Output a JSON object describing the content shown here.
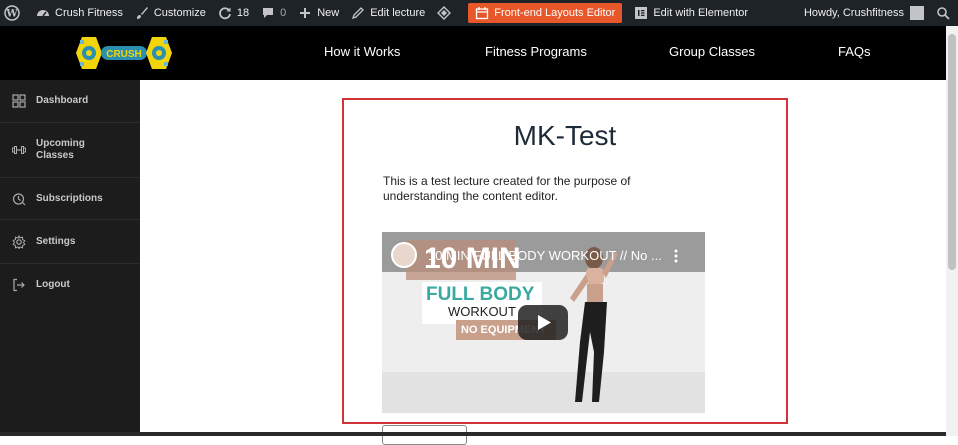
{
  "admin_bar": {
    "site_name": "Crush Fitness",
    "customize": "Customize",
    "updates_count": "18",
    "comments_count": "0",
    "new": "New",
    "edit_lecture": "Edit lecture",
    "layouts_editor": "Front-end Layouts Editor",
    "edit_elementor": "Edit with Elementor",
    "howdy": "Howdy, Crushfitness"
  },
  "header": {
    "logo_text": "CRUSH",
    "nav": [
      "How it Works",
      "Fitness Programs",
      "Group Classes",
      "FAQs"
    ]
  },
  "sidebar": {
    "items": [
      {
        "label": "Dashboard",
        "icon": "dashboard-icon"
      },
      {
        "label": "Upcoming",
        "label2": "Classes",
        "icon": "dumbbell-icon"
      },
      {
        "label": "Subscriptions",
        "icon": "subscriptions-icon"
      },
      {
        "label": "Settings",
        "icon": "gear-icon"
      },
      {
        "label": "Logout",
        "icon": "logout-icon"
      }
    ]
  },
  "lecture": {
    "title": "MK-Test",
    "description": "This is a test lecture created for the purpose of understanding the content editor."
  },
  "video": {
    "title": "10 MIN FULL BODY WORKOUT // No ...",
    "thumb_line1": "10 MIN",
    "thumb_line2": "FULL BODY",
    "thumb_line3": "WORKOUT",
    "thumb_line4": "NO EQUIPMENT"
  },
  "colors": {
    "admin_bar": "#1d2327",
    "highlight": "#e8572a",
    "sidebar": "#1c1c1c",
    "box_border": "#d13438",
    "teal": "#3aa9a0"
  }
}
